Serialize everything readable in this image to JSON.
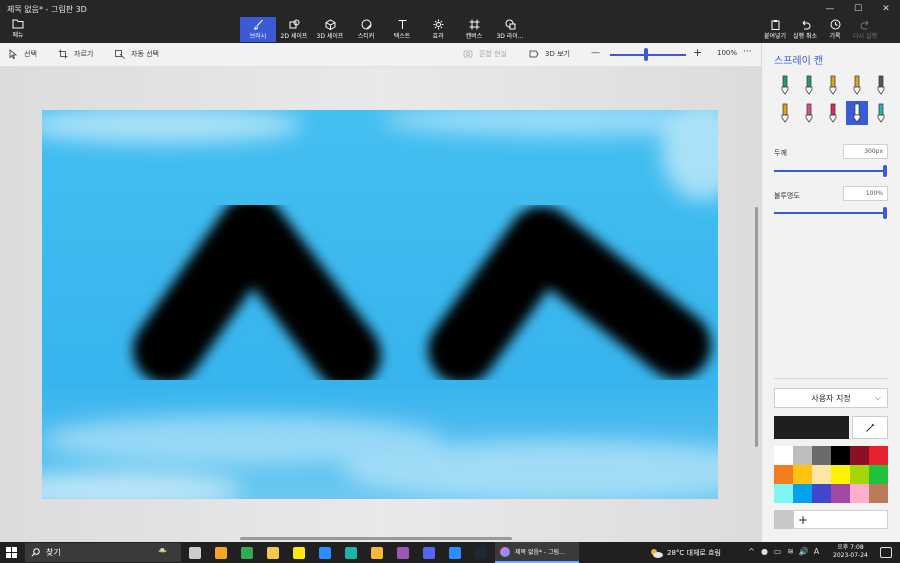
{
  "app": {
    "title": "제목 없음* - 그림판 3D",
    "window_controls": [
      "—",
      "☐",
      "✕"
    ]
  },
  "ribbon": {
    "menu_label": "메뉴",
    "tools": [
      {
        "label": "브러시",
        "icon": "brush-icon",
        "active": true
      },
      {
        "label": "2D 셰이프",
        "icon": "2d-shape-icon",
        "active": false
      },
      {
        "label": "3D 셰이프",
        "icon": "3d-shape-icon",
        "active": false
      },
      {
        "label": "스티커",
        "icon": "sticker-icon",
        "active": false
      },
      {
        "label": "텍스트",
        "icon": "text-icon",
        "active": false
      },
      {
        "label": "효과",
        "icon": "effects-icon",
        "active": false
      },
      {
        "label": "캔버스",
        "icon": "canvas-icon",
        "active": false
      },
      {
        "label": "3D 라이...",
        "icon": "3d-library-icon",
        "active": false
      }
    ],
    "right_tools": [
      {
        "label": "붙여넣기",
        "icon": "paste-icon",
        "enabled": true
      },
      {
        "label": "실행 취소",
        "icon": "undo-icon",
        "enabled": true
      },
      {
        "label": "기록",
        "icon": "history-icon",
        "enabled": true
      },
      {
        "label": "다시 실행",
        "icon": "redo-icon",
        "enabled": false
      }
    ]
  },
  "toolbar2": {
    "select_label": "선택",
    "crop_label": "자르기",
    "magic_select_label": "자동 선택",
    "mixed_reality_label": "혼합 현실",
    "view_3d_label": "3D 보기",
    "zoom_minus": "—",
    "zoom_plus": "+",
    "zoom_value": "100%",
    "zoom_level": 0.47,
    "more_label": "···"
  },
  "canvas": {
    "sky_color": "#2fb0ec",
    "stroke_color": "#000000"
  },
  "panel": {
    "title": "스프레이 캔",
    "brushes": [
      {
        "icon": "marker-icon",
        "color": "#1a9a86",
        "active": false
      },
      {
        "icon": "calligraphy-pen-icon",
        "color": "#1a9a86",
        "active": false
      },
      {
        "icon": "oil-brush-icon",
        "color": "#e8a020",
        "active": false
      },
      {
        "icon": "watercolor-icon",
        "color": "#e8a020",
        "active": false
      },
      {
        "icon": "pixel-pen-icon",
        "color": "#555555",
        "active": false
      },
      {
        "icon": "pencil-icon",
        "color": "#e8a020",
        "active": false
      },
      {
        "icon": "eraser-icon",
        "color": "#e84c7a",
        "active": false
      },
      {
        "icon": "crayon-icon",
        "color": "#e8245a",
        "active": false
      },
      {
        "icon": "spray-can-icon",
        "color": "#ffffff",
        "active": true
      },
      {
        "icon": "fill-icon",
        "color": "#2bb5a8",
        "active": false
      }
    ],
    "thickness_label": "두께",
    "thickness_value": "300px",
    "thickness_level": 1.0,
    "opacity_label": "불투명도",
    "opacity_value": "100%",
    "opacity_level": 1.0,
    "color_mode": "사용자 지정",
    "current_color": "#1f1f1f",
    "palette": [
      "#ffffff",
      "#bdbdbd",
      "#6b6b6b",
      "#000000",
      "#8b0f25",
      "#e8212e",
      "#f47c20",
      "#ffc20e",
      "#fbe6a6",
      "#fff200",
      "#a6d608",
      "#1ec23c",
      "#7ff6f3",
      "#00a3ec",
      "#3f48cc",
      "#a349a4",
      "#ffaec9",
      "#b97a57"
    ],
    "custom_colors": [
      "#c8c8c8"
    ],
    "add_color_label": "+"
  },
  "taskbar": {
    "search_label": "찾기",
    "apps": [
      {
        "icon": "task-view-icon",
        "color": "#cccccc"
      },
      {
        "icon": "orange-app-icon",
        "color": "#f5a623"
      },
      {
        "icon": "chrome-icon",
        "color": "#34a853"
      },
      {
        "icon": "file-explorer-icon",
        "color": "#f2c94c"
      },
      {
        "icon": "kakaotalk-icon",
        "color": "#ffe812"
      },
      {
        "icon": "store-icon",
        "color": "#2d8cff"
      },
      {
        "icon": "edge-icon",
        "color": "#1fb5a6"
      },
      {
        "icon": "chrome-canary-icon",
        "color": "#f6b93b"
      },
      {
        "icon": "paint-icon",
        "color": "#9b59b6"
      },
      {
        "icon": "discord-icon",
        "color": "#5865f2"
      },
      {
        "icon": "zoom-icon",
        "color": "#2d8cff"
      },
      {
        "icon": "steam-icon",
        "color": "#1b2838"
      }
    ],
    "active_app_label": "제목 없음* - 그림...",
    "weather": "28°C 대체로 흐림",
    "tray_icons": [
      "^",
      "●",
      "▭",
      "≋",
      "🔊",
      "A"
    ],
    "time": "오후 7:08",
    "date": "2023-07-24"
  }
}
